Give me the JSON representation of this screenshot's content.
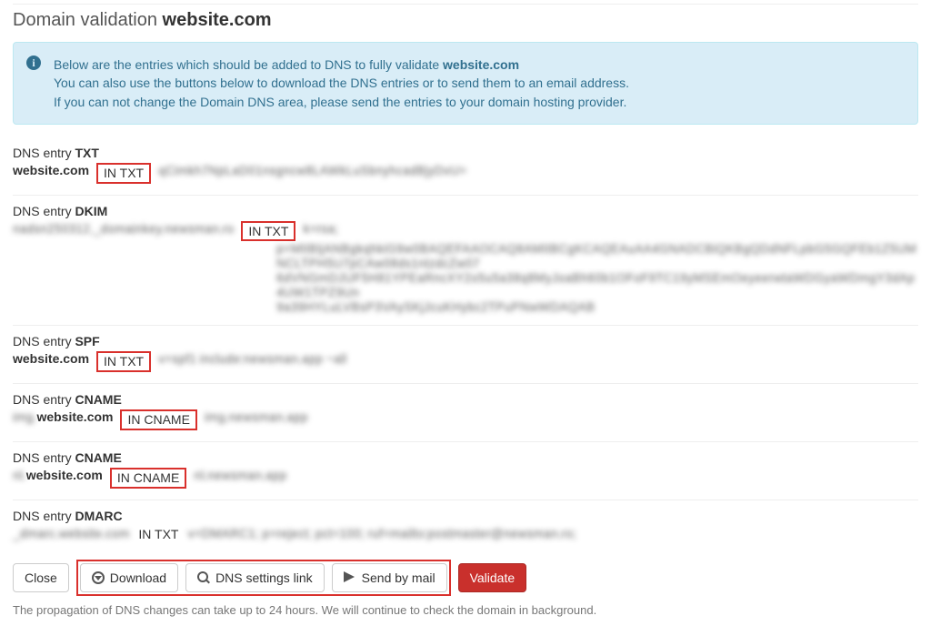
{
  "page": {
    "title_prefix": "Domain validation",
    "domain": "website.com"
  },
  "alert": {
    "line1_a": "Below are the entries which should be added to DNS to fully validate ",
    "line1_b": "website.com",
    "line2": "You can also use the buttons below to download the DNS entries or to send them to an email address.",
    "line3": "If you can not change the Domain DNS area, please send the entries to your domain hosting provider."
  },
  "entries": [
    {
      "label": "DNS entry",
      "type": "TXT",
      "host_prefix": "",
      "host_bold": "website.com",
      "record": "IN TXT",
      "record_boxed": true,
      "value_lines": [
        "qCimkh7NpLaD01nsgncw8LAWkLuSbnyhcadBjyDvU="
      ],
      "indent_value": false
    },
    {
      "label": "DNS entry",
      "type": "DKIM",
      "host_prefix": "nadsn250312._domainkey.newsman.ro",
      "host_bold": "",
      "record": "IN TXT",
      "record_boxed": true,
      "value_lines": [
        "k=rsa;",
        "p=MIIBIjANBgkqhkiG9w0BAQEFAAOCAQ8AMIIBCgKCAQEAuAA4GNADCBiQKBgQDdNFLpbG5GQFEb1Z5UMNCLTPH5U7pCAw08ds1ntzdcZw07",
        "6dVNGmDJUF5H81YPEaRncXY2o5u5a38q8MyJoaBh60b1OFoF9TC19yMSEmOeyeerwtaWDGyaWDmgY3dAp4UW1TPZ9Un",
        "9a39HYLuLVBsP3VAySKjJcuKHybc2TPuPNwWDAQAB"
      ],
      "indent_value": true
    },
    {
      "label": "DNS entry",
      "type": "SPF",
      "host_prefix": "",
      "host_bold": "website.com",
      "record": "IN TXT",
      "record_boxed": true,
      "value_lines": [
        "v=spf1 include:newsman.app ~all"
      ],
      "indent_value": false
    },
    {
      "label": "DNS entry",
      "type": "CNAME",
      "host_prefix": "img.",
      "host_bold": "website.com",
      "record": "IN CNAME",
      "record_boxed": true,
      "value_lines": [
        "img.newsman.app"
      ],
      "indent_value": false
    },
    {
      "label": "DNS entry",
      "type": "CNAME",
      "host_prefix": "nl.",
      "host_bold": "website.com",
      "record": "IN CNAME",
      "record_boxed": true,
      "value_lines": [
        "nl.newsman.app"
      ],
      "indent_value": false
    },
    {
      "label": "DNS entry",
      "type": "DMARC",
      "host_prefix": "_dmarc.website.com",
      "host_bold": "",
      "record": "IN TXT",
      "record_boxed": false,
      "value_lines": [
        "v=DMARC1; p=reject; pct=100; ruf=mailto:postmaster@newsman.ro;"
      ],
      "indent_value": false
    }
  ],
  "buttons": {
    "close": "Close",
    "download": "Download",
    "dns_link": "DNS settings link",
    "send_mail": "Send by mail",
    "validate": "Validate"
  },
  "footnote": "The propagation of DNS changes can take up to 24 hours. We will continue to check the domain in background."
}
